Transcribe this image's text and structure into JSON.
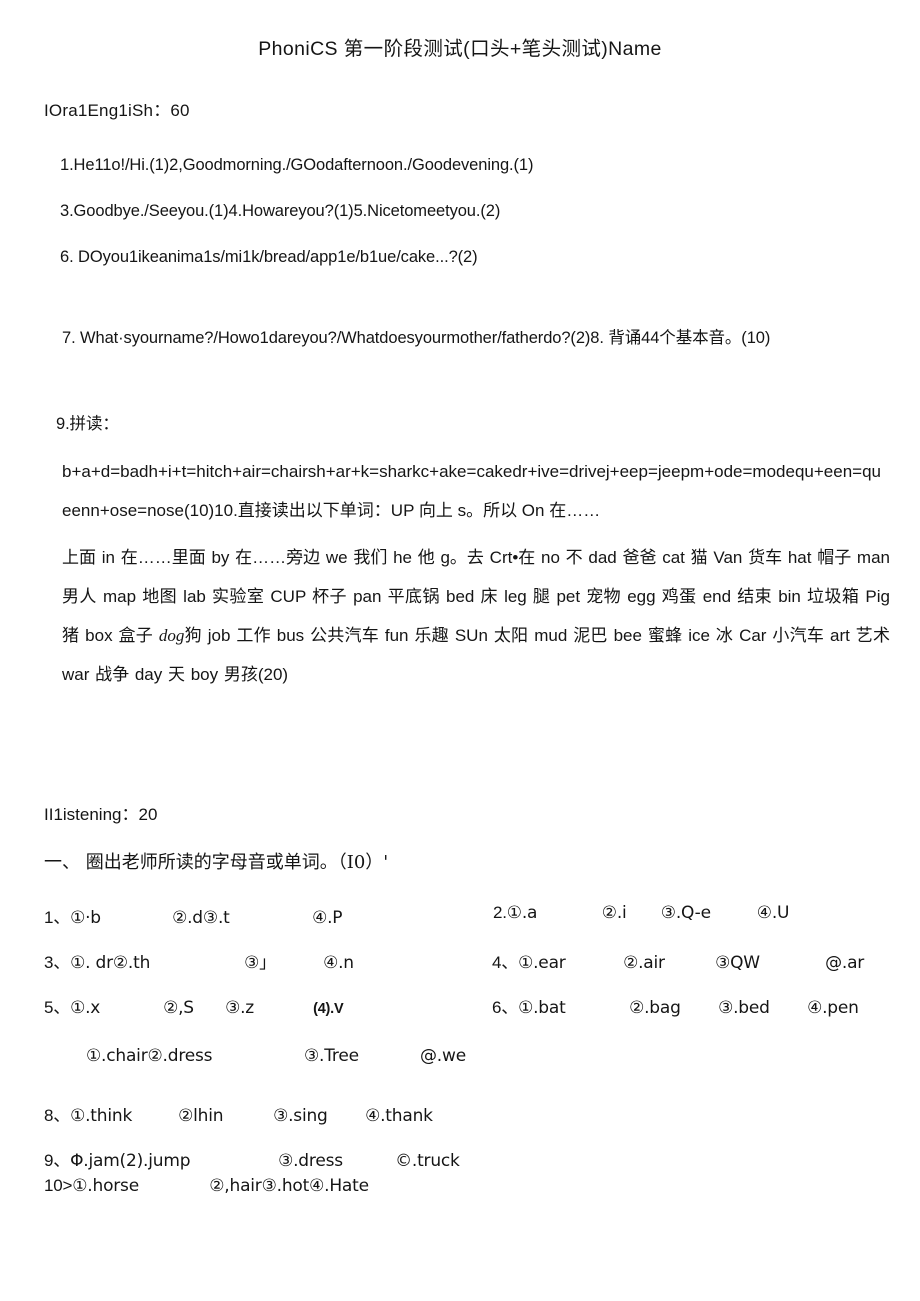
{
  "document": {
    "title": "PhoniCS 第一阶段测试(口头+笔头测试)Name",
    "section_oral": {
      "heading": "IOra1Eng1iSh：60",
      "items": [
        "1.He11o!/Hi.(1)2,Goodmorning./GOodafternoon./Goodevening.(1)",
        "3.Goodbye./Seeyou.(1)4.Howareyou?(1)5.Nicetomeetyou.(2)",
        "6.  DOyou1ikeanima1s/mi1k/bread/app1e/b1ue/cake...?(2)",
        "7.  What·syourname?/Howo1dareyou?/Whatdoesyourmother/fatherdo?(2)8. 背诵44个基本音。(10)",
        "9.拼读："
      ],
      "blend_text": "b+a+d=badh+i+t=hitch+air=chairsh+ar+k=sharkc+ake=cakedr+ive=drivej+eep=jeepm+ode=modequ+een=queenn+ose=nose(10)10.直接读出以下单词：UP 向上 s。所以 On 在……",
      "vocab_text": "上面 in 在……里面 by 在……旁边 we 我们 he 他 g。去 Crt•在 no 不 dad 爸爸 cat 猫 Van 货车 hat 帽子 man 男人 map 地图 lab 实验室 CUP 杯子 pan 平底锅 bed 床 leg 腿 pet 宠物 egg 鸡蛋 end 结束 bin 垃圾箱 Pig 猪 box 盒子 ",
      "vocab_italic_word": "dog",
      "vocab_text_2": "狗 job 工作 bus 公共汽车 fun 乐趣 SUn 太阳 mud 泥巴 bee 蜜蜂 ice 冰 Car 小汽车 art 艺术 war 战争 day 天 boy 男孩(20)"
    },
    "section_listening": {
      "heading": "II1istening：20",
      "instruction": "一、 圈出老师所读的字母音或单词。（I0）'",
      "questions": [
        {
          "number": "1、",
          "options": [
            "①·b",
            "②.d③.t",
            "④.P"
          ],
          "column": "left",
          "row": 1
        },
        {
          "number": "2.",
          "options": [
            "①.a",
            "②.i",
            "③.Q-e",
            "④.U"
          ],
          "column": "right",
          "row": 1
        },
        {
          "number": "3、",
          "options": [
            "①. dr②.th",
            "③」",
            "④.n"
          ],
          "column": "left",
          "row": 2
        },
        {
          "number": "4、",
          "options": [
            "①.ear",
            "②.air",
            "③QW",
            "@.ar"
          ],
          "column": "right",
          "row": 2
        },
        {
          "number": "5、",
          "options": [
            "①.x",
            "②,S",
            "③.z",
            "(4).V"
          ],
          "column": "left",
          "row": 3
        },
        {
          "number": "6、",
          "options": [
            "①.bat",
            "②.bag",
            "③.bed",
            "④.pen"
          ],
          "column": "right",
          "row": 3
        },
        {
          "number": "",
          "options": [
            "①.chair②.dress",
            "③.Tree",
            "@.we"
          ],
          "column": "left",
          "row": 4
        },
        {
          "number": "8、",
          "options": [
            "①.think",
            "②lhin",
            "③.sing",
            "④.thank"
          ],
          "column": "left",
          "row": 5
        },
        {
          "number": "9、",
          "options": [
            "Φ.jam(2).jump",
            "③.dress",
            "©.truck"
          ],
          "column": "left",
          "row": 6
        },
        {
          "number": "10>",
          "options": [
            "①.horse",
            "②,hair③.hot④.Hate"
          ],
          "column": "left",
          "row": 7
        }
      ]
    }
  }
}
